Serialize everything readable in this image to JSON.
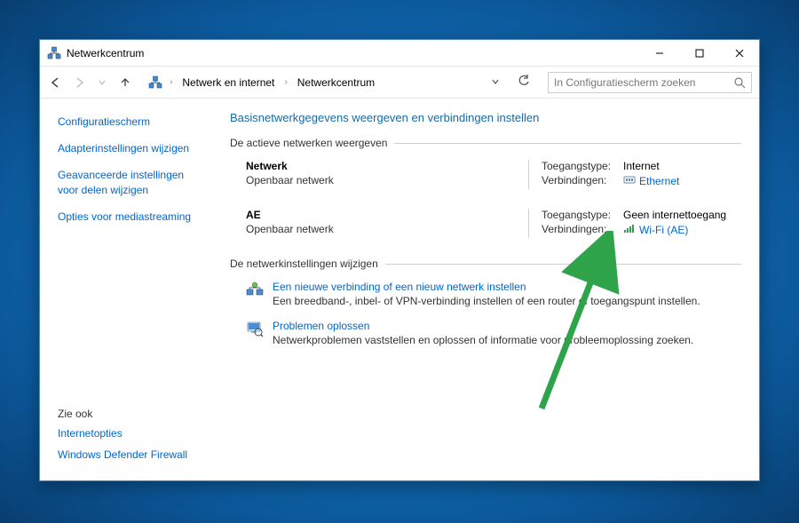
{
  "window": {
    "title": "Netwerkcentrum"
  },
  "breadcrumb": {
    "root_icon": "network-control-panel-icon",
    "items": [
      "Netwerk en internet",
      "Netwerkcentrum"
    ]
  },
  "search": {
    "placeholder": "In Configuratiescherm zoeken"
  },
  "sidebar": {
    "control_panel": "Configuratiescherm",
    "links": [
      "Adapterinstellingen wijzigen",
      "Geavanceerde instellingen voor delen wijzigen",
      "Opties voor mediastreaming"
    ],
    "see_also_header": "Zie ook",
    "see_also": [
      "Internetopties",
      "Windows Defender Firewall"
    ]
  },
  "main": {
    "heading": "Basisnetwerkgegevens weergeven en verbindingen instellen",
    "active_networks_label": "De actieve netwerken weergeven",
    "networks": [
      {
        "name": "Netwerk",
        "subtype": "Openbaar netwerk",
        "access_label": "Toegangstype:",
        "access_value": "Internet",
        "conn_label": "Verbindingen:",
        "conn_value": "Ethernet",
        "conn_icon": "ethernet"
      },
      {
        "name": "AE",
        "subtype": "Openbaar netwerk",
        "access_label": "Toegangstype:",
        "access_value": "Geen internettoegang",
        "conn_label": "Verbindingen:",
        "conn_value": "Wi-Fi (AE)",
        "conn_icon": "wifi"
      }
    ],
    "change_settings_label": "De netwerkinstellingen wijzigen",
    "actions": [
      {
        "title": "Een nieuwe verbinding of een nieuw netwerk instellen",
        "desc": "Een breedband-, inbel- of VPN-verbinding instellen of een router of toegangspunt instellen."
      },
      {
        "title": "Problemen oplossen",
        "desc": "Netwerkproblemen vaststellen en oplossen of informatie voor probleemoplossing zoeken."
      }
    ]
  }
}
